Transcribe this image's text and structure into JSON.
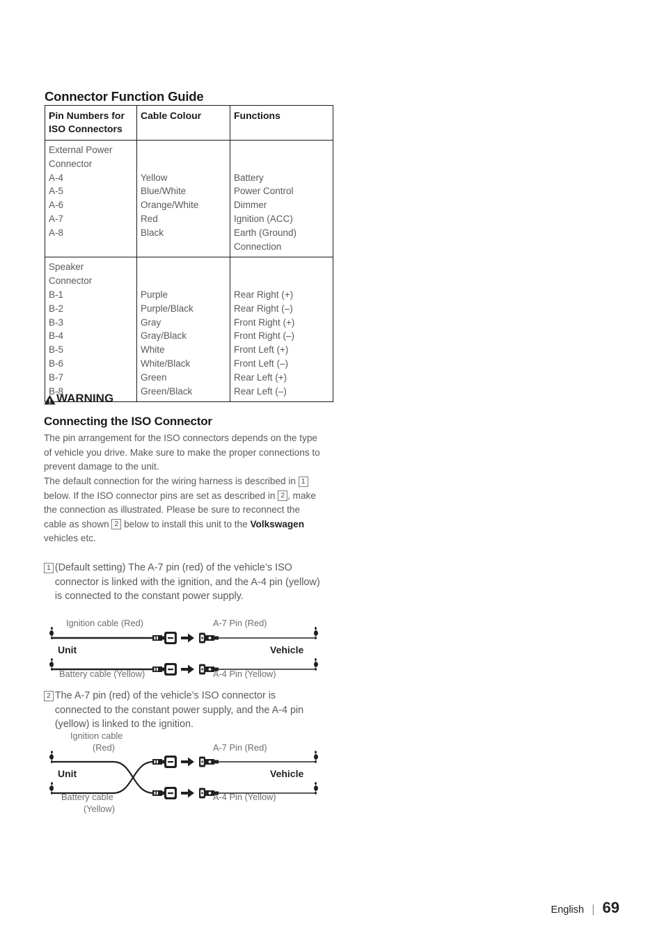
{
  "document": {
    "section_title": "Connector Function Guide"
  },
  "table": {
    "headers": [
      "Pin Numbers for\nISO Connectors",
      "Cable Colour",
      "Functions"
    ],
    "header_lines": [
      [
        "Pin Numbers for",
        "ISO Connectors"
      ],
      [
        "Cable Colour",
        ""
      ],
      [
        "Functions",
        ""
      ]
    ],
    "groups": [
      {
        "name": "External Power Connector",
        "pin_lines": [
          "External Power",
          "Connector",
          "A-4",
          "A-5",
          "A-6",
          "A-7",
          "A-8"
        ],
        "colour_lines": [
          "",
          "",
          "Yellow",
          "Blue/White",
          "Orange/White",
          "Red",
          "Black"
        ],
        "function_lines": [
          "",
          "",
          "Battery",
          "Power Control",
          "Dimmer",
          "Ignition (ACC)",
          "Earth (Ground)",
          "Connection"
        ],
        "rows": [
          {
            "pin": "A-4",
            "colour": "Yellow",
            "function": "Battery"
          },
          {
            "pin": "A-5",
            "colour": "Blue/White",
            "function": "Power Control"
          },
          {
            "pin": "A-6",
            "colour": "Orange/White",
            "function": "Dimmer"
          },
          {
            "pin": "A-7",
            "colour": "Red",
            "function": "Ignition (ACC)"
          },
          {
            "pin": "A-8",
            "colour": "Black",
            "function": "Earth (Ground) Connection"
          }
        ]
      },
      {
        "name": "Speaker Connector",
        "pin_lines": [
          "Speaker",
          "Connector",
          "B-1",
          "B-2",
          "B-3",
          "B-4",
          "B-5",
          "B-6",
          "B-7",
          "B-8"
        ],
        "colour_lines": [
          "",
          "",
          "Purple",
          "Purple/Black",
          "Gray",
          "Gray/Black",
          "White",
          "White/Black",
          "Green",
          "Green/Black"
        ],
        "function_lines": [
          "",
          "",
          "Rear Right (+)",
          "Rear Right (–)",
          "Front Right (+)",
          "Front Right (–)",
          "Front Left (+)",
          "Front Left (–)",
          "Rear Left (+)",
          "Rear Left (–)"
        ],
        "rows": [
          {
            "pin": "B-1",
            "colour": "Purple",
            "function": "Rear Right (+)"
          },
          {
            "pin": "B-2",
            "colour": "Purple/Black",
            "function": "Rear Right (–)"
          },
          {
            "pin": "B-3",
            "colour": "Gray",
            "function": "Front Right (+)"
          },
          {
            "pin": "B-4",
            "colour": "Gray/Black",
            "function": "Front Right (–)"
          },
          {
            "pin": "B-5",
            "colour": "White",
            "function": "Front Left (+)"
          },
          {
            "pin": "B-6",
            "colour": "White/Black",
            "function": "Front Left (–)"
          },
          {
            "pin": "B-7",
            "colour": "Green",
            "function": "Rear Left (+)"
          },
          {
            "pin": "B-8",
            "colour": "Green/Black",
            "function": "Rear Left (–)"
          }
        ]
      }
    ]
  },
  "warning": {
    "label": "WARNING",
    "heading": "Connecting the ISO Connector",
    "paragraph_1": "The pin arrangement for the ISO connectors depends on the type of vehicle you drive. Make sure to make the proper connections to prevent damage to the unit.",
    "paragraph_2_part1": "The default connection for the wiring harness is described in ",
    "paragraph_2_num1": "1",
    "paragraph_2_part2": " below. If the ISO connector pins are set as described in ",
    "paragraph_2_num2": "2",
    "paragraph_2_part3": ", make the connection as illustrated.",
    "paragraph_3_part1": "Please be sure to reconnect the cable as shown ",
    "paragraph_3_num": "2",
    "paragraph_3_part2": " below to install this unit to the ",
    "paragraph_3_bold": "Volkswagen",
    "paragraph_3_part3": " vehicles etc."
  },
  "items": [
    {
      "number": "1",
      "text": "(Default setting) The A-7 pin (red) of the vehicle’s ISO connector is linked with the ignition, and the A-4 pin (yellow) is connected to the constant power supply."
    },
    {
      "number": "2",
      "text": "The A-7 pin (red) of the vehicle’s ISO connector is connected to the constant power supply, and the A-4 pin (yellow) is linked to the ignition."
    }
  ],
  "diagram_1": {
    "top_left_label": "Ignition cable (Red)",
    "top_right_label": "A-7 Pin (Red)",
    "unit_label": "Unit",
    "vehicle_label": "Vehicle",
    "bottom_left_label": "Battery cable (Yellow)",
    "bottom_right_label": "A-4 Pin (Yellow)"
  },
  "diagram_2": {
    "top_left_label_line1": "Ignition cable",
    "top_left_label_line2": "(Red)",
    "top_right_label": "A-7 Pin (Red)",
    "unit_label": "Unit",
    "vehicle_label": "Vehicle",
    "bottom_left_label_line1": "Battery cable",
    "bottom_left_label_line2": "(Yellow)",
    "bottom_right_label": "A-4 Pin (Yellow)"
  },
  "footer": {
    "language": "English",
    "separator": "|",
    "page_number": "69"
  },
  "colors": {
    "text_body": "#59595c",
    "text_dark": "#231f20",
    "rule": "#1a1a1a"
  }
}
